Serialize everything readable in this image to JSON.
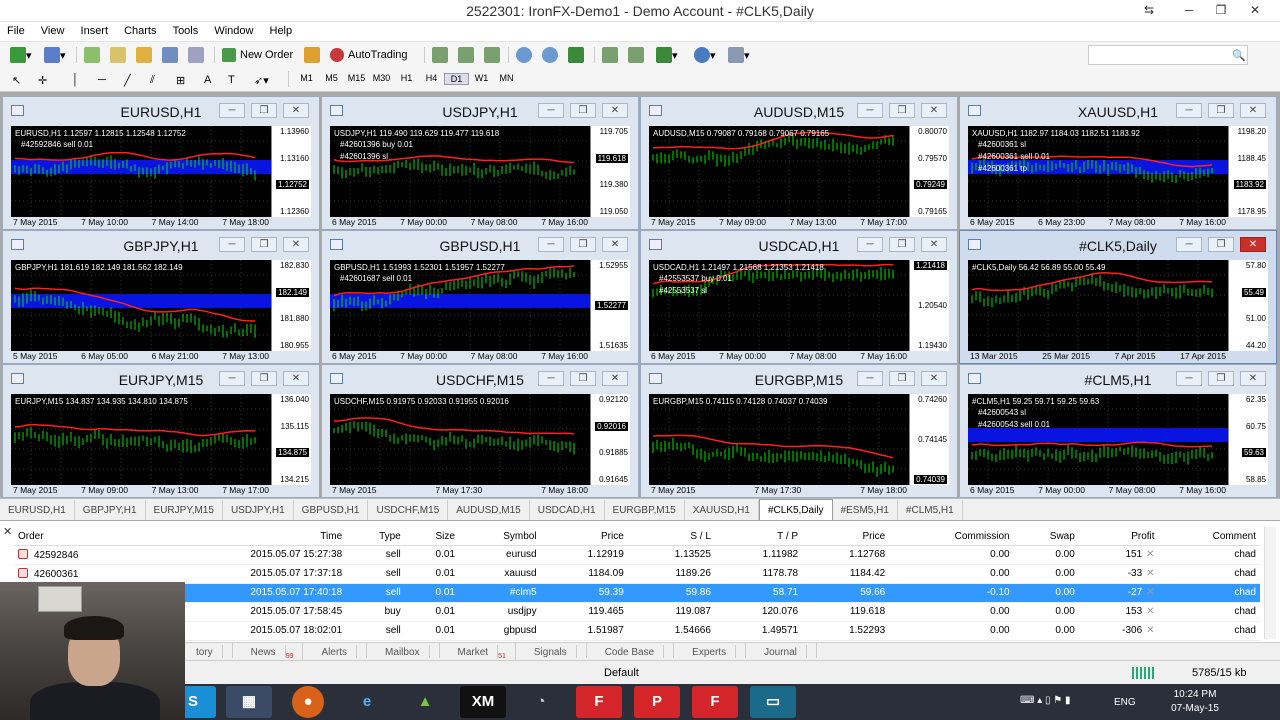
{
  "window": {
    "title": "2522301: IronFX-Demo1 - Demo Account - #CLK5,Daily"
  },
  "menu": [
    "File",
    "View",
    "Insert",
    "Charts",
    "Tools",
    "Window",
    "Help"
  ],
  "toolbar": {
    "new_order": "New Order",
    "autotrading": "AutoTrading"
  },
  "timeframes": [
    "M1",
    "M5",
    "M15",
    "M30",
    "H1",
    "H4",
    "D1",
    "W1",
    "MN"
  ],
  "charts": [
    {
      "title": "EURUSD,H1",
      "header": "EURUSD,H1  1.12597 1.12815 1.12548 1.12752",
      "prices": [
        "1.13960",
        "1.13160",
        "1.12752",
        "1.12360"
      ],
      "hl": 2,
      "dates": [
        "7 May 2015",
        "7 May 10:00",
        "7 May 14:00",
        "7 May 18:00"
      ],
      "annos": [
        "#42592846 sell 0.01"
      ],
      "blue": true
    },
    {
      "title": "USDJPY,H1",
      "header": "USDJPY,H1  119.490 119.629 119.477 119.618",
      "prices": [
        "119.705",
        "119.618",
        "119.380",
        "119.050"
      ],
      "hl": 1,
      "dates": [
        "6 May 2015",
        "7 May 00:00",
        "7 May 08:00",
        "7 May 16:00"
      ],
      "annos": [
        "#42601396 buy 0.01",
        "#42601396 sl"
      ],
      "blue": false
    },
    {
      "title": "AUDUSD,M15",
      "header": "AUDUSD,M15  0.79087 0.79168 0.79067 0.79165",
      "prices": [
        "0.80070",
        "0.79570",
        "0.79249",
        "0.79165"
      ],
      "hl": 2,
      "dates": [
        "7 May 2015",
        "7 May 09:00",
        "7 May 13:00",
        "7 May 17:00"
      ],
      "annos": [],
      "blue": false
    },
    {
      "title": "XAUUSD,H1",
      "header": "XAUUSD,H1  1182.97 1184.03 1182.51 1183.92",
      "prices": [
        "1198.20",
        "1188.45",
        "1183.92",
        "1178.95"
      ],
      "hl": 2,
      "dates": [
        "6 May 2015",
        "6 May 23:00",
        "7 May 08:00",
        "7 May 16:00"
      ],
      "annos": [
        "#42600361 sl",
        "#42600361 sell 0.01",
        "#42600361 tp"
      ],
      "blue": true
    },
    {
      "title": "GBPJPY,H1",
      "header": "GBPJPY,H1  181.619 182.149 181.562 182.149",
      "prices": [
        "182.830",
        "182.149",
        "181.880",
        "180.955"
      ],
      "hl": 1,
      "dates": [
        "5 May 2015",
        "6 May 05:00",
        "6 May 21:00",
        "7 May 13:00"
      ],
      "annos": [],
      "blue": true
    },
    {
      "title": "GBPUSD,H1",
      "header": "GBPUSD,H1  1.51993 1.52301 1.51957 1.52277",
      "prices": [
        "1.52955",
        "1.52277",
        "1.51635"
      ],
      "hl": 1,
      "dates": [
        "6 May 2015",
        "7 May 00:00",
        "7 May 08:00",
        "7 May 16:00"
      ],
      "annos": [
        "#42601687 sell 0.01"
      ],
      "blue": true
    },
    {
      "title": "USDCAD,H1",
      "header": "USDCAD,H1  1.21497 1.21568 1.21353 1.21418",
      "prices": [
        "1.21418",
        "1.20540",
        "1.19430"
      ],
      "hl": 0,
      "dates": [
        "6 May 2015",
        "7 May 00:00",
        "7 May 08:00",
        "7 May 16:00"
      ],
      "annos": [
        "#42553537 buy 0.01",
        "#42553537 sl"
      ],
      "blue": false
    },
    {
      "title": "#CLK5,Daily",
      "header": "#CLK5,Daily  56.42 56.89 55.00 55.49",
      "prices": [
        "57.80",
        "55.49",
        "51.00",
        "44.20"
      ],
      "hl": 1,
      "dates": [
        "13 Mar 2015",
        "25 Mar 2015",
        "7 Apr 2015",
        "17 Apr 2015"
      ],
      "annos": [],
      "blue": false,
      "active": true
    },
    {
      "title": "EURJPY,M15",
      "header": "EURJPY,M15  134.837 134.935 134.810 134.875",
      "prices": [
        "136.040",
        "135.115",
        "134.875",
        "134.215"
      ],
      "hl": 2,
      "dates": [
        "7 May 2015",
        "7 May 09:00",
        "7 May 13:00",
        "7 May 17:00"
      ],
      "annos": [],
      "blue": false
    },
    {
      "title": "USDCHF,M15",
      "header": "USDCHF,M15  0.91975 0.92033 0.91955 0.92016",
      "prices": [
        "0.92120",
        "0.92016",
        "0.91885",
        "0.91645"
      ],
      "hl": 1,
      "dates": [
        "7 May 2015",
        "7 May 17:30",
        "7 May 18:00"
      ],
      "annos": [],
      "blue": false
    },
    {
      "title": "EURGBP,M15",
      "header": "EURGBP,M15  0.74115 0.74128 0.74037 0.74039",
      "prices": [
        "0.74260",
        "0.74145",
        "0.74039"
      ],
      "hl": 2,
      "dates": [
        "7 May 2015",
        "7 May 17:30",
        "7 May 18:00"
      ],
      "annos": [],
      "blue": false
    },
    {
      "title": "#CLM5,H1",
      "header": "#CLM5,H1  59.25 59.71 59.25 59.63",
      "prices": [
        "62.35",
        "60.75",
        "59.63",
        "58.85"
      ],
      "hl": 2,
      "dates": [
        "6 May 2015",
        "7 May 00:00",
        "7 May 08:00",
        "7 May 16:00"
      ],
      "annos": [
        "#42600543 sl",
        "#42600543 sell 0.01"
      ],
      "blue": true
    }
  ],
  "symbol_tabs": [
    "EURUSD,H1",
    "GBPJPY,H1",
    "EURJPY,M15",
    "USDJPY,H1",
    "GBPUSD,H1",
    "USDCHF,M15",
    "AUDUSD,M15",
    "USDCAD,H1",
    "EURGBP,M15",
    "XAUUSD,H1",
    "#CLK5,Daily",
    "#ESM5,H1",
    "#CLM5,H1"
  ],
  "active_symbol_tab": "#CLK5,Daily",
  "orders": {
    "columns": [
      "Order",
      "Time",
      "Type",
      "Size",
      "Symbol",
      "Price",
      "S / L",
      "T / P",
      "Price",
      "Commission",
      "Swap",
      "Profit",
      "Comment"
    ],
    "rows": [
      [
        "42592846",
        "2015.05.07 15:27:38",
        "sell",
        "0.01",
        "eurusd",
        "1.12919",
        "1.13525",
        "1.11982",
        "1.12768",
        "0.00",
        "0.00",
        "151",
        "chad"
      ],
      [
        "42600361",
        "2015.05.07 17:37:18",
        "sell",
        "0.01",
        "xauusd",
        "1184.09",
        "1189.26",
        "1178.78",
        "1184.42",
        "0.00",
        "0.00",
        "-33",
        "chad"
      ],
      [
        "",
        "2015.05.07 17:40:18",
        "sell",
        "0.01",
        "#clm5",
        "59.39",
        "59.86",
        "58.71",
        "59.66",
        "-0.10",
        "0.00",
        "-27",
        "chad"
      ],
      [
        "",
        "2015.05.07 17:58:45",
        "buy",
        "0.01",
        "usdjpy",
        "119.465",
        "119.087",
        "120.076",
        "119.618",
        "0.00",
        "0.00",
        "153",
        "chad"
      ],
      [
        "",
        "2015.05.07 18:02:01",
        "sell",
        "0.01",
        "gbpusd",
        "1.51987",
        "1.54666",
        "1.49571",
        "1.52293",
        "0.00",
        "0.00",
        "-306",
        "chad"
      ]
    ],
    "selected_row": 2
  },
  "terminal_tabs": [
    "tory",
    "News",
    "Alerts",
    "Mailbox",
    "Market",
    "Signals",
    "Code Base",
    "Experts",
    "Journal"
  ],
  "news_badge": "99",
  "market_badge": "51",
  "status": {
    "profile": "Default",
    "traffic": "5785/15 kb"
  },
  "taskbar": {
    "lang": "ENG",
    "time": "10:24 PM",
    "date": "07-May-15"
  }
}
